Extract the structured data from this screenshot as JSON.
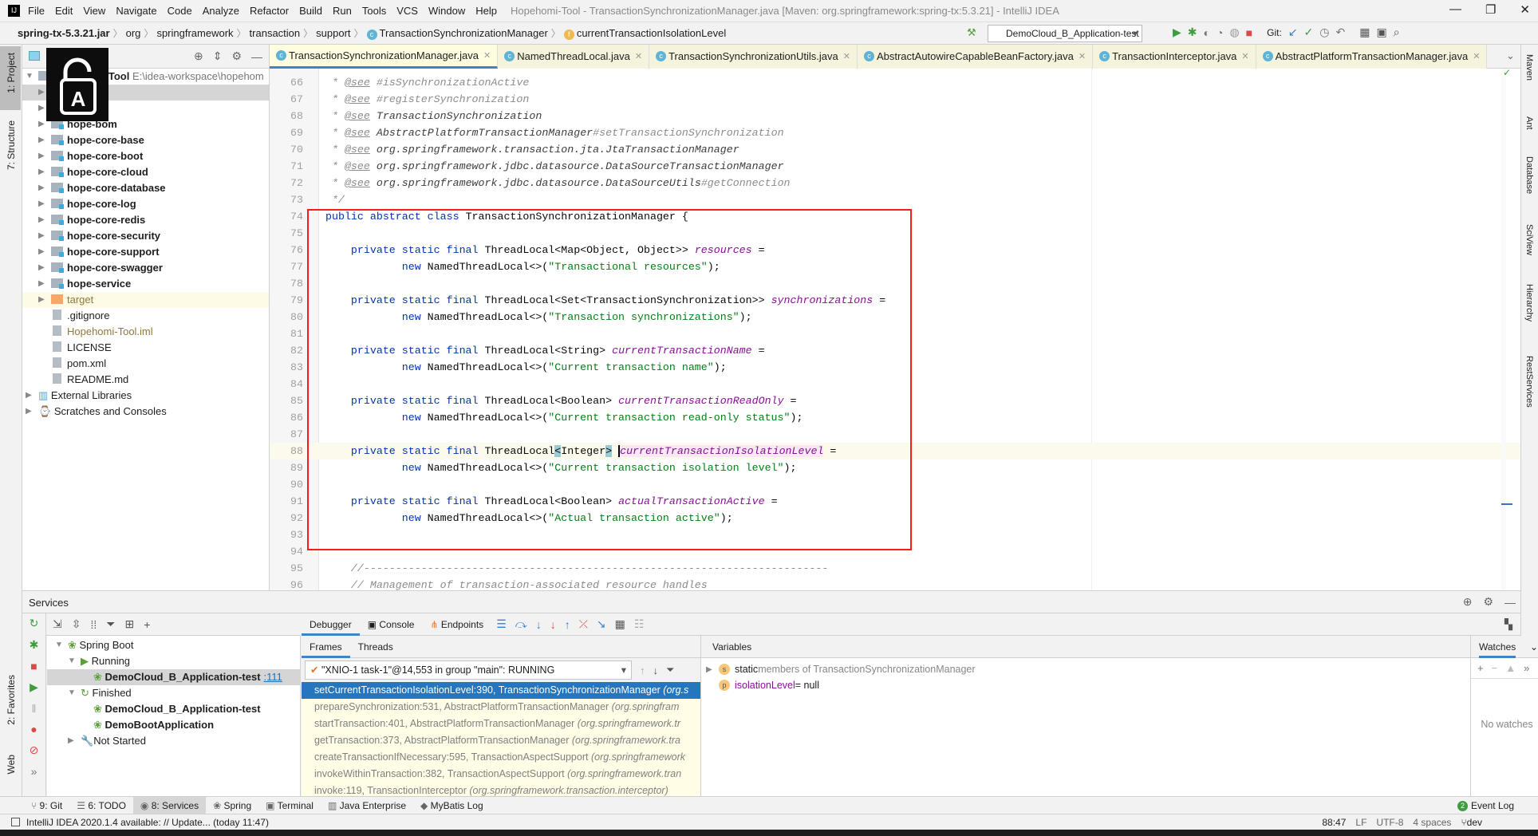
{
  "window": {
    "title": "Hopehomi-Tool - TransactionSynchronizationManager.java [Maven: org.springframework:spring-tx:5.3.21] - IntelliJ IDEA"
  },
  "menu": [
    "File",
    "Edit",
    "View",
    "Navigate",
    "Code",
    "Analyze",
    "Refactor",
    "Build",
    "Run",
    "Tools",
    "VCS",
    "Window",
    "Help"
  ],
  "breadcrumb": [
    "spring-tx-5.3.21.jar",
    "org",
    "springframework",
    "transaction",
    "support",
    "TransactionSynchronizationManager",
    "currentTransactionIsolationLevel"
  ],
  "toolbar": {
    "run_config": "DemoCloud_B_Application-test",
    "git_label": "Git:"
  },
  "left_strip": [
    "1: Project",
    "7: Structure",
    "2: Favorites",
    "Web"
  ],
  "right_strip": [
    "Maven",
    "Ant",
    "Database",
    "SciView",
    "Hierarchy",
    "RestServices"
  ],
  "project": {
    "root": "Hopehomi-Tool",
    "root_path": "E:\\idea-workspace\\hopehom",
    "items": [
      {
        "label": "",
        "type": "module",
        "depth": 1,
        "arrow": true
      },
      {
        "label": "",
        "type": "module",
        "depth": 1,
        "arrow": true
      },
      {
        "label": "hope-bom",
        "type": "module",
        "depth": 1,
        "arrow": true,
        "bold": true
      },
      {
        "label": "hope-core-base",
        "type": "module",
        "depth": 1,
        "arrow": true,
        "bold": true
      },
      {
        "label": "hope-core-boot",
        "type": "module",
        "depth": 1,
        "arrow": true,
        "bold": true
      },
      {
        "label": "hope-core-cloud",
        "type": "module",
        "depth": 1,
        "arrow": true,
        "bold": true
      },
      {
        "label": "hope-core-database",
        "type": "module",
        "depth": 1,
        "arrow": true,
        "bold": true
      },
      {
        "label": "hope-core-log",
        "type": "module",
        "depth": 1,
        "arrow": true,
        "bold": true
      },
      {
        "label": "hope-core-redis",
        "type": "module",
        "depth": 1,
        "arrow": true,
        "bold": true
      },
      {
        "label": "hope-core-security",
        "type": "module",
        "depth": 1,
        "arrow": true,
        "bold": true
      },
      {
        "label": "hope-core-support",
        "type": "module",
        "depth": 1,
        "arrow": true,
        "bold": true
      },
      {
        "label": "hope-core-swagger",
        "type": "module",
        "depth": 1,
        "arrow": true,
        "bold": true
      },
      {
        "label": "hope-service",
        "type": "module",
        "depth": 1,
        "arrow": true,
        "bold": true
      },
      {
        "label": "target",
        "type": "target",
        "depth": 1,
        "arrow": true
      },
      {
        "label": ".gitignore",
        "type": "file",
        "depth": 1
      },
      {
        "label": "Hopehomi-Tool.iml",
        "type": "iml",
        "depth": 1
      },
      {
        "label": "LICENSE",
        "type": "file",
        "depth": 1
      },
      {
        "label": "pom.xml",
        "type": "file",
        "depth": 1
      },
      {
        "label": "README.md",
        "type": "file",
        "depth": 1
      },
      {
        "label": "External Libraries",
        "type": "lib",
        "depth": 0,
        "arrow": true
      },
      {
        "label": "Scratches and Consoles",
        "type": "lib",
        "depth": 0,
        "arrow": true
      }
    ]
  },
  "editor_tabs": [
    {
      "label": "TransactionSynchronizationManager.java",
      "active": true
    },
    {
      "label": "NamedThreadLocal.java"
    },
    {
      "label": "TransactionSynchronizationUtils.java"
    },
    {
      "label": "AbstractAutowireCapableBeanFactory.java"
    },
    {
      "label": "TransactionInterceptor.java"
    },
    {
      "label": "AbstractPlatformTransactionManager.java"
    }
  ],
  "code": {
    "current_line": 88,
    "lines": [
      {
        "n": 66,
        "t": [
          [
            " * ",
            "c"
          ],
          [
            "@see",
            "t"
          ],
          [
            " #isSynchronizationActive",
            "c"
          ]
        ]
      },
      {
        "n": 67,
        "t": [
          [
            " * ",
            "c"
          ],
          [
            "@see",
            "t"
          ],
          [
            " #registerSynchronization",
            "c"
          ]
        ]
      },
      {
        "n": 68,
        "t": [
          [
            " * ",
            "c"
          ],
          [
            "@see",
            "t"
          ],
          [
            " ",
            "c"
          ],
          [
            "TransactionSynchronization",
            "r"
          ]
        ]
      },
      {
        "n": 69,
        "t": [
          [
            " * ",
            "c"
          ],
          [
            "@see",
            "t"
          ],
          [
            " ",
            "c"
          ],
          [
            "AbstractPlatformTransactionManager",
            "r"
          ],
          [
            "#setTransactionSynchronization",
            "c"
          ]
        ]
      },
      {
        "n": 70,
        "t": [
          [
            " * ",
            "c"
          ],
          [
            "@see",
            "t"
          ],
          [
            " ",
            "c"
          ],
          [
            "org.springframework.transaction.jta.JtaTransactionManager",
            "r"
          ]
        ]
      },
      {
        "n": 71,
        "t": [
          [
            " * ",
            "c"
          ],
          [
            "@see",
            "t"
          ],
          [
            " ",
            "c"
          ],
          [
            "org.springframework.jdbc.datasource.DataSourceTransactionManager",
            "r"
          ]
        ]
      },
      {
        "n": 72,
        "t": [
          [
            " * ",
            "c"
          ],
          [
            "@see",
            "t"
          ],
          [
            " ",
            "c"
          ],
          [
            "org.springframework.jdbc.datasource.DataSourceUtils",
            "r"
          ],
          [
            "#getConnection",
            "c"
          ]
        ]
      },
      {
        "n": 73,
        "t": [
          [
            " */",
            "c"
          ]
        ]
      },
      {
        "n": 74,
        "t": [
          [
            "public abstract class ",
            "k"
          ],
          [
            "TransactionSynchronizationManager {",
            "p"
          ]
        ]
      },
      {
        "n": 75,
        "t": []
      },
      {
        "n": 76,
        "t": [
          [
            "    private static final ",
            "k"
          ],
          [
            "ThreadLocal<Map<Object, Object>> ",
            "p"
          ],
          [
            "resources",
            "f"
          ],
          [
            " =",
            "p"
          ]
        ]
      },
      {
        "n": 77,
        "t": [
          [
            "            new ",
            "k"
          ],
          [
            "NamedThreadLocal<>(",
            "p"
          ],
          [
            "\"Transactional resources\"",
            "s"
          ],
          [
            ");",
            "p"
          ]
        ]
      },
      {
        "n": 78,
        "t": []
      },
      {
        "n": 79,
        "t": [
          [
            "    private static final ",
            "k"
          ],
          [
            "ThreadLocal<Set<TransactionSynchronization>> ",
            "p"
          ],
          [
            "synchronizations",
            "f"
          ],
          [
            " =",
            "p"
          ]
        ]
      },
      {
        "n": 80,
        "t": [
          [
            "            new ",
            "k"
          ],
          [
            "NamedThreadLocal<>(",
            "p"
          ],
          [
            "\"Transaction synchronizations\"",
            "s"
          ],
          [
            ");",
            "p"
          ]
        ]
      },
      {
        "n": 81,
        "t": []
      },
      {
        "n": 82,
        "t": [
          [
            "    private static final ",
            "k"
          ],
          [
            "ThreadLocal<String> ",
            "p"
          ],
          [
            "currentTransactionName",
            "f"
          ],
          [
            " =",
            "p"
          ]
        ]
      },
      {
        "n": 83,
        "t": [
          [
            "            new ",
            "k"
          ],
          [
            "NamedThreadLocal<>(",
            "p"
          ],
          [
            "\"Current transaction name\"",
            "s"
          ],
          [
            ");",
            "p"
          ]
        ]
      },
      {
        "n": 84,
        "t": []
      },
      {
        "n": 85,
        "t": [
          [
            "    private static final ",
            "k"
          ],
          [
            "ThreadLocal<Boolean> ",
            "p"
          ],
          [
            "currentTransactionReadOnly",
            "f"
          ],
          [
            " =",
            "p"
          ]
        ]
      },
      {
        "n": 86,
        "t": [
          [
            "            new ",
            "k"
          ],
          [
            "NamedThreadLocal<>(",
            "p"
          ],
          [
            "\"Current transaction read-only status\"",
            "s"
          ],
          [
            ");",
            "p"
          ]
        ]
      },
      {
        "n": 87,
        "t": []
      },
      {
        "n": 88,
        "t": [
          [
            "    private static final ",
            "k"
          ],
          [
            "ThreadLocal",
            "p"
          ],
          [
            "<",
            "b"
          ],
          [
            "Integer",
            "p"
          ],
          [
            ">",
            "b"
          ],
          [
            " ",
            "p"
          ],
          [
            "currentTransactionIsolationLevel",
            "fh"
          ],
          [
            " =",
            "p"
          ]
        ]
      },
      {
        "n": 89,
        "t": [
          [
            "            new ",
            "k"
          ],
          [
            "NamedThreadLocal<>(",
            "p"
          ],
          [
            "\"Current transaction isolation level\"",
            "s"
          ],
          [
            ");",
            "p"
          ]
        ]
      },
      {
        "n": 90,
        "t": []
      },
      {
        "n": 91,
        "t": [
          [
            "    private static final ",
            "k"
          ],
          [
            "ThreadLocal<Boolean> ",
            "p"
          ],
          [
            "actualTransactionActive",
            "f"
          ],
          [
            " =",
            "p"
          ]
        ]
      },
      {
        "n": 92,
        "t": [
          [
            "            new ",
            "k"
          ],
          [
            "NamedThreadLocal<>(",
            "p"
          ],
          [
            "\"Actual transaction active\"",
            "s"
          ],
          [
            ");",
            "p"
          ]
        ]
      },
      {
        "n": 93,
        "t": []
      },
      {
        "n": 94,
        "t": []
      },
      {
        "n": 95,
        "t": [
          [
            "    //-------------------------------------------------------------------------",
            "c"
          ]
        ]
      },
      {
        "n": 96,
        "t": [
          [
            "    // Management of transaction-associated resource handles",
            "c"
          ]
        ]
      }
    ]
  },
  "services": {
    "title": "Services",
    "tree": [
      {
        "label": "Spring Boot",
        "depth": 0,
        "arrow": "down"
      },
      {
        "label": "Running",
        "depth": 1,
        "arrow": "down"
      },
      {
        "label": "DemoCloud_B_Application-test",
        "suffix": ":111",
        "depth": 2,
        "bold": true,
        "selected": true
      },
      {
        "label": "Finished",
        "depth": 1,
        "arrow": "down"
      },
      {
        "label": "DemoCloud_B_Application-test",
        "depth": 2,
        "bold": true
      },
      {
        "label": "DemoBootApplication",
        "depth": 2,
        "bold": true
      },
      {
        "label": "Not Started",
        "depth": 1,
        "arrow": "right"
      }
    ]
  },
  "debugger": {
    "tabs": [
      "Debugger",
      "Console",
      "Endpoints"
    ],
    "frame_tabs": [
      "Frames",
      "Threads"
    ],
    "thread": "\"XNIO-1 task-1\"@14,553 in group \"main\": RUNNING",
    "frames": [
      {
        "m": "setCurrentTransactionIsolationLevel:390, TransactionSynchronizationManager",
        "pkg": "(org.s"
      },
      {
        "m": "prepareSynchronization:531, AbstractPlatformTransactionManager",
        "pkg": "(org.springfram"
      },
      {
        "m": "startTransaction:401, AbstractPlatformTransactionManager",
        "pkg": "(org.springframework.tr"
      },
      {
        "m": "getTransaction:373, AbstractPlatformTransactionManager",
        "pkg": "(org.springframework.tra"
      },
      {
        "m": "createTransactionIfNecessary:595, TransactionAspectSupport",
        "pkg": "(org.springframework"
      },
      {
        "m": "invokeWithinTransaction:382, TransactionAspectSupport",
        "pkg": "(org.springframework.tran"
      },
      {
        "m": "invoke:119, TransactionInterceptor",
        "pkg": "(org.springframework.transaction.interceptor)"
      }
    ],
    "variables_title": "Variables",
    "variables": [
      {
        "badge": "s",
        "name": "static",
        "rest": " members of TransactionSynchronizationManager",
        "expandable": true
      },
      {
        "badge": "p",
        "name": "isolationLevel",
        "rest": " = null"
      }
    ],
    "watches_title": "Watches",
    "no_watches": "No watches"
  },
  "bottom_tabs": [
    {
      "label": "9: Git"
    },
    {
      "label": "6: TODO"
    },
    {
      "label": "8: Services",
      "active": true
    },
    {
      "label": "Spring"
    },
    {
      "label": "Terminal"
    },
    {
      "label": "Java Enterprise"
    },
    {
      "label": "MyBatis Log"
    }
  ],
  "event_log": {
    "label": "Event Log",
    "count": "2"
  },
  "status": {
    "message": "IntelliJ IDEA 2020.1.4 available: // Update... (today 11:47)",
    "position": "88:47",
    "line_sep": "LF",
    "encoding": "UTF-8",
    "indent": "4 spaces",
    "branch": "dev"
  },
  "colors": {
    "accent": "#4083c9",
    "selection": "#2675bf",
    "annotation_box": "#ff1a1a",
    "keyword": "#0033b3",
    "string": "#067d17",
    "field": "#871094"
  }
}
